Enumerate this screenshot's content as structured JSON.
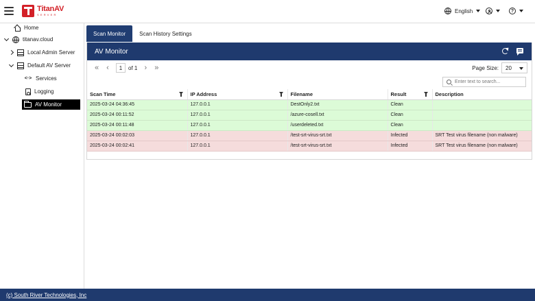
{
  "header": {
    "logo_name": "TitanAV",
    "logo_sub": "SERVER",
    "language": "English",
    "help_symbol": "?"
  },
  "sidebar": {
    "items": [
      {
        "label": "Home"
      },
      {
        "label": "titanav.cloud"
      },
      {
        "label": "Local Admin Server"
      },
      {
        "label": "Default AV Server"
      },
      {
        "label": "Services",
        "icon_text": "<·>"
      },
      {
        "label": "Logging"
      },
      {
        "label": "AV Monitor"
      }
    ]
  },
  "tabs": [
    {
      "label": "Scan Monitor",
      "active": true
    },
    {
      "label": "Scan History Settings",
      "active": false
    }
  ],
  "panel": {
    "title": "AV Monitor"
  },
  "pager": {
    "first": "«",
    "prev": "‹",
    "page": "1",
    "of_text": "of 1",
    "next": "›",
    "last": "»",
    "page_size_label": "Page Size:",
    "page_size_value": "20"
  },
  "search": {
    "placeholder": "Enter text to search..."
  },
  "table": {
    "columns": [
      "Scan Time",
      "IP Address",
      "Filename",
      "Result",
      "Description"
    ],
    "rows": [
      {
        "status": "clean",
        "cells": [
          "2025-03-24 04:36:45",
          "127.0.0.1",
          "DestOnly2.txt",
          "Clean",
          ""
        ]
      },
      {
        "status": "clean",
        "cells": [
          "2025-03-24 00:11:52",
          "127.0.0.1",
          "/azure-cosell.txt",
          "Clean",
          ""
        ]
      },
      {
        "status": "clean",
        "cells": [
          "2025-03-24 00:11:48",
          "127.0.0.1",
          "/userdeleted.txt",
          "Clean",
          ""
        ]
      },
      {
        "status": "infected",
        "cells": [
          "2025-03-24 00:02:03",
          "127.0.0.1",
          "/test-srt-virus-srt.txt",
          "Infected",
          "SRT Test virus filename (non malware)"
        ]
      },
      {
        "status": "infected",
        "cells": [
          "2025-03-24 00:02:41",
          "127.0.0.1",
          "/test-srt-virus-srt.txt",
          "Infected",
          "SRT Test virus filename (non malware)"
        ]
      }
    ]
  },
  "footer": {
    "copyright": "(c) South River Technologies, Inc"
  },
  "colors": {
    "brand_red": "#d32027",
    "header_navy": "#1f3a6e",
    "clean_row": "#dcfbd7",
    "infected_row": "#f5dcdc"
  }
}
